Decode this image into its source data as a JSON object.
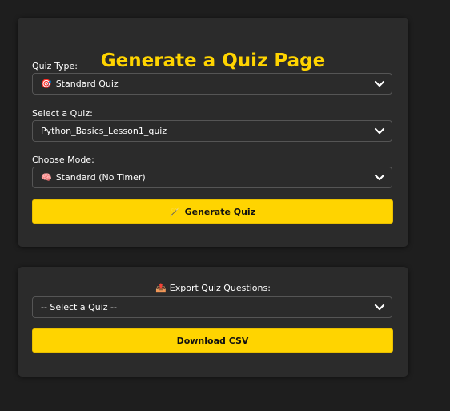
{
  "generator": {
    "title": "Generate a Quiz Page",
    "quiz_type": {
      "label": "Quiz Type:",
      "icon": "🎯",
      "value": "Standard Quiz"
    },
    "select_quiz": {
      "label": "Select a Quiz:",
      "value": "Python_Basics_Lesson1_quiz"
    },
    "mode": {
      "label": "Choose Mode:",
      "icon": "🧠",
      "value": "Standard (No Timer)"
    },
    "generate_button": {
      "icon": "🪄",
      "label": "Generate Quiz"
    }
  },
  "export": {
    "icon": "📤",
    "label": "Export Quiz Questions:",
    "select_value": "-- Select a Quiz --",
    "download_label": "Download CSV"
  },
  "colors": {
    "accent": "#ffd400",
    "background": "#1e1e1e",
    "card": "#2b2b2b"
  }
}
